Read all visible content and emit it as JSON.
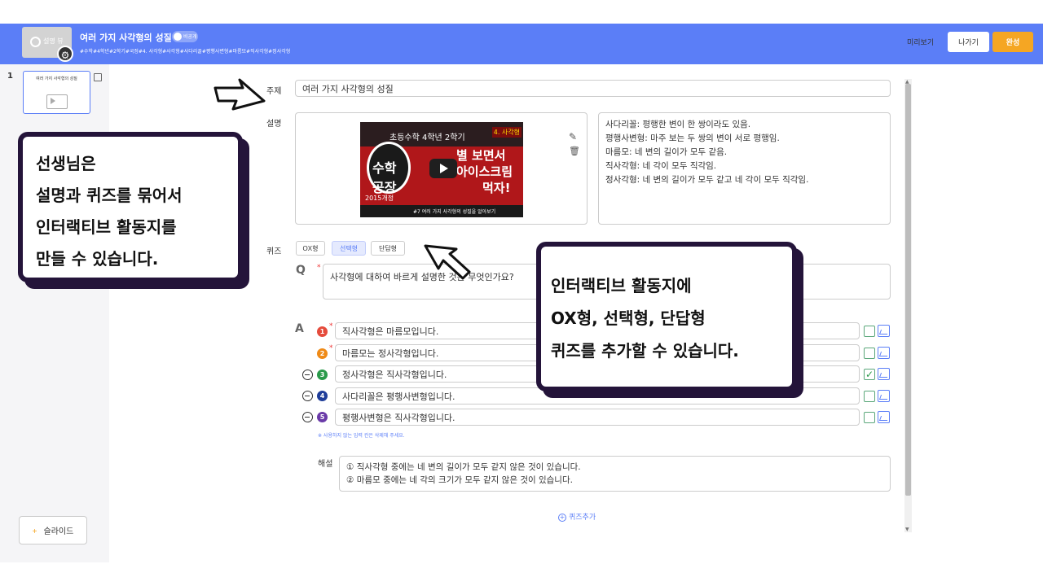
{
  "header": {
    "thumbnail_label": "설명 뷰",
    "title": "여러 가지 사각형의 성질",
    "visibility_toggle": "비공개",
    "tags": "#수학#4학년#2학기#국정#4. 사각형#사각형#사다리꼴#평행사변형#마름모#직사각형#정사각형",
    "preview_label": "미리보기",
    "exit_label": "나가기",
    "done_label": "완성",
    "brand_color": "#5b7ef7",
    "done_color": "#f5a623"
  },
  "sidebar": {
    "slide_number": "1",
    "slide_title": "여러 가지 사각형의 성질",
    "add_slide_label": "슬라이드"
  },
  "editor": {
    "subject_label": "주제",
    "subject_value": "여러 가지 사각형의 성질",
    "description_label": "설명",
    "video": {
      "line1": "초등수학 4학년 2학기",
      "badge": "4. 사각형",
      "logo": "수학공장",
      "right1": "별 보면서",
      "right2": "아이스크림",
      "right3": "먹자!",
      "bottom": "#7 여러 가지 사각형의 성질을 알아보기",
      "year": "2015개정"
    },
    "description_lines": [
      "사다리꼴: 평행한 변이 한 쌍이라도 있음.",
      "평행사변형: 마주 보는 두 쌍의 변이 서로 평행임.",
      "마름모: 네 변의 길이가 모두 같음.",
      "직사각형: 네 각이 모두 직각임.",
      "정사각형: 네 변의 길이가 모두 같고 네 각이 모두 직각임."
    ],
    "quiz_label": "퀴즈",
    "quiz_types": [
      "OX형",
      "선택형",
      "단답형"
    ],
    "selected_quiz_type": "선택형",
    "q_marker": "Q",
    "question": "사각형에 대하여 바르게 설명한 것은 무엇인가요?",
    "a_marker": "A",
    "answers": [
      {
        "num": "1",
        "text": "직사각형은 마름모입니다.",
        "correct": false,
        "color": "#e54b3c"
      },
      {
        "num": "2",
        "text": "마름모는 정사각형입니다.",
        "correct": false,
        "color": "#ef8a17"
      },
      {
        "num": "3",
        "text": "정사각형은 직사각형입니다.",
        "correct": true,
        "color": "#2a9a4a"
      },
      {
        "num": "4",
        "text": "사다리꼴은 평행사변형입니다.",
        "correct": false,
        "color": "#1f3d99"
      },
      {
        "num": "5",
        "text": "평행사변형은 직사각형입니다.",
        "correct": false,
        "color": "#6a3aa8"
      }
    ],
    "answer_note": "※ 사용하지 않는 입력 칸은 삭제해 주세요.",
    "explanation_label": "해설",
    "explanation_lines": [
      "① 직사각형 중에는 네 변의 길이가 모두 같지 않은 것이 있습니다.",
      "② 마름모 중에는 네 각의 크기가 모두 같지 않은 것이 있습니다."
    ],
    "add_quiz_label": "퀴즈추가"
  },
  "callouts": {
    "left": [
      "선생님은",
      "설명과 퀴즈를 묶어서",
      "인터랙티브 활동지를",
      "만들 수 있습니다."
    ],
    "right": [
      "인터랙티브 활동지에",
      "OX형, 선택형, 단답형",
      "퀴즈를 추가할 수 있습니다."
    ]
  }
}
